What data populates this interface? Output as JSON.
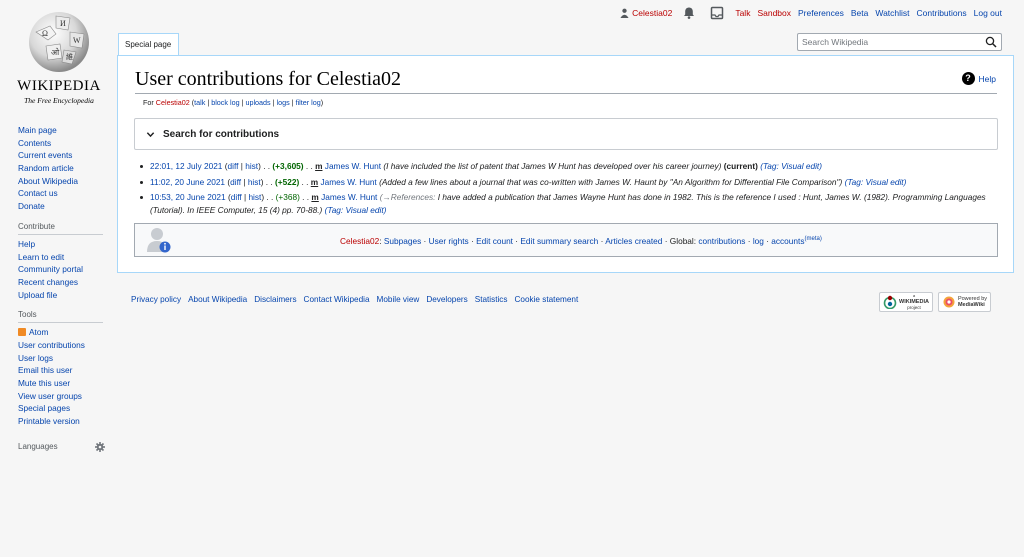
{
  "personal": {
    "username": "Celestia02",
    "links": [
      "Talk",
      "Sandbox",
      "Preferences",
      "Beta",
      "Watchlist",
      "Contributions",
      "Log out"
    ]
  },
  "logo": {
    "wordmark": "WIKIPEDIA",
    "tagline": "The Free Encyclopedia"
  },
  "sidebar": {
    "nav": [
      "Main page",
      "Contents",
      "Current events",
      "Random article",
      "About Wikipedia",
      "Contact us",
      "Donate"
    ],
    "contribute_heading": "Contribute",
    "contribute": [
      "Help",
      "Learn to edit",
      "Community portal",
      "Recent changes",
      "Upload file"
    ],
    "tools_heading": "Tools",
    "tools_first": "Atom",
    "tools": [
      "User contributions",
      "User logs",
      "Email this user",
      "Mute this user",
      "View user groups",
      "Special pages",
      "Printable version"
    ],
    "languages_heading": "Languages"
  },
  "tab": {
    "label": "Special page"
  },
  "search": {
    "placeholder": "Search Wikipedia"
  },
  "page": {
    "title": "User contributions for Celestia02",
    "help": "Help",
    "subtitle": {
      "for": "For",
      "user": "Celestia02",
      "talk": "talk",
      "block_log": "block log",
      "uploads": "uploads",
      "logs": "logs",
      "filter_log": "filter log"
    },
    "search_box_label": "Search for contributions"
  },
  "contributions": [
    {
      "date": "22:01, 12 July 2021",
      "diff": "diff",
      "hist": "hist",
      "size": "(+3,605)",
      "minor": "m",
      "page": "James W. Hunt",
      "comment": "(I have included the list of patent that James W Hunt has developed over his career journey)",
      "current": "(current)",
      "tag": "(Tag: Visual edit)"
    },
    {
      "date": "11:02, 20 June 2021",
      "diff": "diff",
      "hist": "hist",
      "size": "(+522)",
      "minor": "m",
      "page": "James W. Hunt",
      "comment": "(Added a few lines about a journal that was co-written with James W. Haunt by \"An Algorithm for Differential File Comparison\")",
      "current": "",
      "tag": "(Tag: Visual edit)"
    },
    {
      "date": "10:53, 20 June 2021",
      "diff": "diff",
      "hist": "hist",
      "size": "(+368)",
      "minor": "m",
      "page": "James W. Hunt",
      "comment_prefix": "(→References:",
      "comment": "I have added a publication that James Wayne Hunt has done in 1982. This is the reference I used : Hunt, James W. (1982). Programming Languages (Tutorial). In IEEE Computer, 15 (4) pp. 70-88.)",
      "current": "",
      "tag": "(Tag: Visual edit)"
    }
  ],
  "userbox": {
    "user": "Celestia02",
    "links": [
      "Subpages",
      "User rights",
      "Edit count",
      "Edit summary search",
      "Articles created"
    ],
    "global": "Global:",
    "global_links": [
      "contributions",
      "log",
      "accounts"
    ],
    "meta": "(meta)"
  },
  "footer": {
    "links": [
      "Privacy policy",
      "About Wikipedia",
      "Disclaimers",
      "Contact Wikipedia",
      "Mobile view",
      "Developers",
      "Statistics",
      "Cookie statement"
    ],
    "badge1": [
      "a",
      "WIKIMEDIA",
      "project"
    ],
    "badge2": [
      "Powered by",
      "MediaWiki"
    ]
  }
}
